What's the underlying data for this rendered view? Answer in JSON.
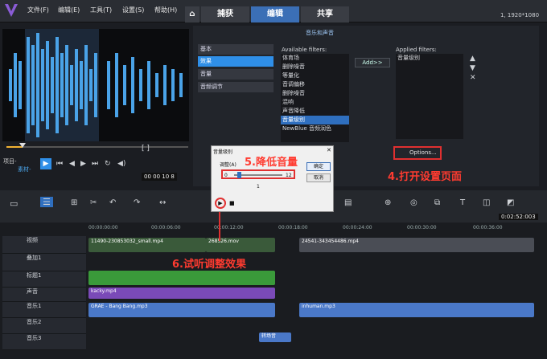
{
  "menu": [
    "文件(F)",
    "编辑(E)",
    "工具(T)",
    "设置(S)",
    "帮助(H)"
  ],
  "tabs": [
    "捕获",
    "编辑",
    "共享"
  ],
  "resolution": "1, 1920*1080",
  "filter_panel": {
    "title": "音乐和声音",
    "categories": [
      "基本",
      "效果",
      "音量",
      "音频调节"
    ],
    "available_label": "Available filters:",
    "applied_label": "Applied filters:",
    "available": [
      "体育场",
      "删除噪音",
      "等量化",
      "音调偏移",
      "删除噪音",
      "混响",
      "声音降低",
      "音量级别",
      "NewBlue 音频润色"
    ],
    "applied": [
      "音量级别"
    ],
    "add_button": "Add>>",
    "options_button": "Options..."
  },
  "annotations": {
    "step4": "4.打开设置页面",
    "step5": "5.降低音量",
    "step6": "6.试听调整效果"
  },
  "dialog": {
    "title": "音量级别",
    "label": "调整(A)",
    "min": "0",
    "max": "12",
    "value": "1",
    "ok": "确定",
    "cancel": "取消"
  },
  "player": {
    "project_label": "项目-",
    "material_label": "素材-",
    "timecode": "00 00 10 8"
  },
  "timeline": {
    "timecode": "0:02:52:003",
    "ruler": [
      "00:00:00:00",
      "00:00:06:00",
      "00:00:12:00",
      "00:00:18:00",
      "00:00:24:00",
      "00:00:30:00",
      "00:00:36:00"
    ],
    "tracks": [
      "视频",
      "叠加1",
      "标题1",
      "声音",
      "音乐1",
      "音乐2",
      "音乐3"
    ],
    "clips": {
      "video1": "11490-230853032_small.mp4",
      "video2": "268526.mov",
      "video3": "24541-343454486.mp4",
      "voice": "kacky.mp4",
      "music1": "GRAE - Bang Bang.mp3",
      "music2": "inhuman.mp3",
      "music3": "转场音"
    }
  },
  "colors": {
    "accent": "#3b6fb6",
    "highlight": "#e03030"
  }
}
